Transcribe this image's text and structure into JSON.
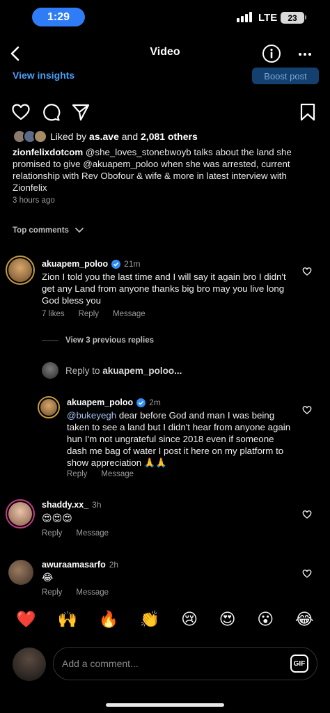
{
  "status": {
    "time": "1:29",
    "network": "LTE",
    "battery": "23"
  },
  "header": {
    "title": "Video"
  },
  "insights": {
    "view_label": "View insights",
    "boost_label": "Boost post"
  },
  "likes": {
    "prefix": "Liked by",
    "user": "as.ave",
    "middle": "and",
    "count": "2,081 others"
  },
  "caption": {
    "username": "zionfelixdotcom",
    "text": "@she_loves_stonebwoyb talks about the land she promised to give @akuapem_poloo when she was arrested, current relationship with Rev Obofour & wife & more in latest interview with Zionfelix",
    "time": "3 hours ago"
  },
  "top_comments_label": "Top comments",
  "comments": [
    {
      "username": "akuapem_poloo",
      "time": "21m",
      "text": "Zion I told you the last time and I will say it again bro I didn't get any Land from anyone thanks big bro may you live long God bless you",
      "likes": "7 likes",
      "reply": "Reply",
      "message": "Message",
      "view_replies": "View 3 previous replies",
      "reply_to": "Reply to",
      "reply_to_user": "akuapem_poloo...",
      "nested": {
        "username": "akuapem_poloo",
        "time": "2m",
        "mention": "@bukeyegh",
        "text": " dear before God and man I was being taken to see a land but I didn't hear from anyone again hun I'm not ungrateful since 2018 even if someone dash me bag of water I post it here on my platform to show appreciation 🙏🙏",
        "reply": "Reply",
        "message": "Message"
      }
    },
    {
      "username": "shaddy.xx_",
      "time": "3h",
      "text": "😍😍😍",
      "reply": "Reply",
      "message": "Message"
    },
    {
      "username": "awuraamasarfo",
      "time": "2h",
      "text": "😂",
      "reply": "Reply",
      "message": "Message"
    }
  ],
  "emoji_bar": [
    "❤️",
    "🙌",
    "🔥",
    "👏",
    "😢",
    "😍",
    "😮",
    "😂"
  ],
  "comment_input": {
    "placeholder": "Add a comment...",
    "gif_label": "GIF"
  },
  "colors": {
    "accent": "#4a9ef5",
    "verified": "#2f8ef5",
    "background": "#000000"
  },
  "icons": [
    "back-icon",
    "info-icon",
    "more-icon",
    "heart-icon",
    "comment-icon",
    "share-icon",
    "bookmark-icon",
    "chevron-down-icon",
    "verified-icon"
  ]
}
